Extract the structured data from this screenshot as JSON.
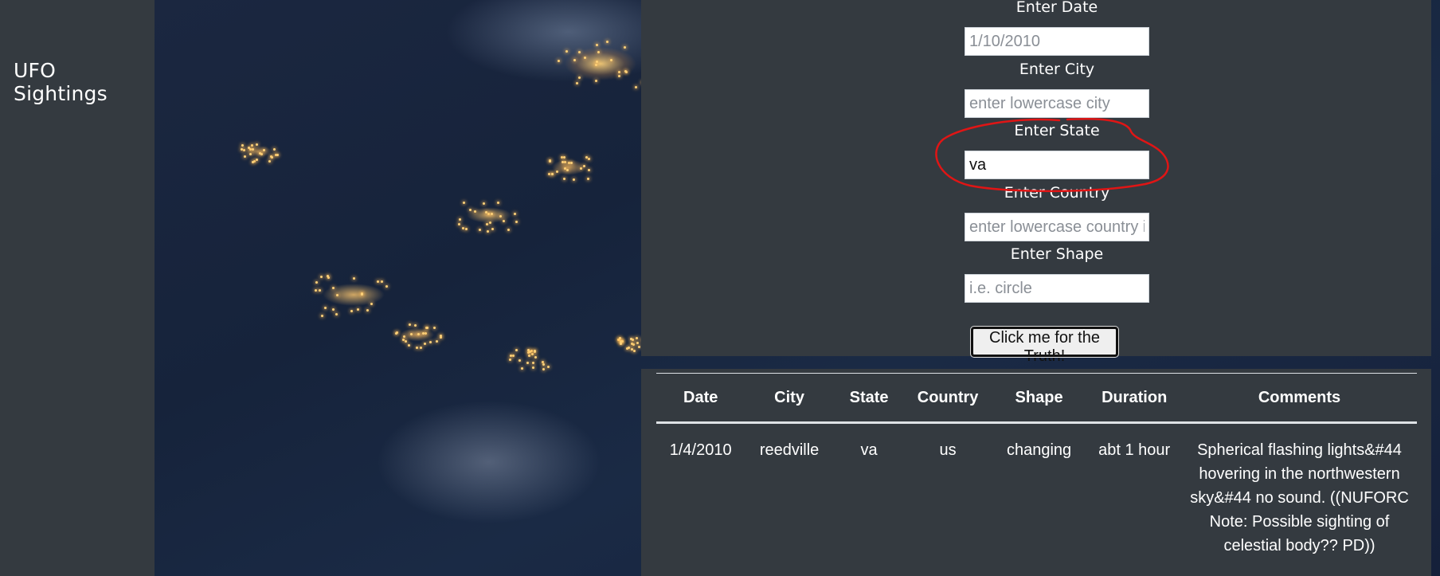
{
  "sidebar": {
    "brand": "UFO Sightings"
  },
  "form": {
    "fields": [
      {
        "label": "Enter Date",
        "value": "",
        "placeholder": "1/10/2010"
      },
      {
        "label": "Enter City",
        "value": "",
        "placeholder": "enter lowercase city"
      },
      {
        "label": "Enter State",
        "value": "va",
        "placeholder": ""
      },
      {
        "label": "Enter Country",
        "value": "",
        "placeholder": "enter lowercase country i"
      },
      {
        "label": "Enter Shape",
        "value": "",
        "placeholder": "i.e. circle"
      }
    ],
    "button_label": "Click me for the Truth!"
  },
  "annotation": {
    "color": "#e01515"
  },
  "table": {
    "headers": [
      "Date",
      "City",
      "State",
      "Country",
      "Shape",
      "Duration",
      "Comments"
    ],
    "rows": [
      {
        "date": "1/4/2010",
        "city": "reedville",
        "state": "va",
        "country": "us",
        "shape": "changing",
        "duration": "abt 1 hour",
        "comments": "Spherical flashing lights&#44 hovering in the northwestern sky&#44 no sound. ((NUFORC Note: Possible sighting of celestial body?? PD))"
      }
    ]
  }
}
